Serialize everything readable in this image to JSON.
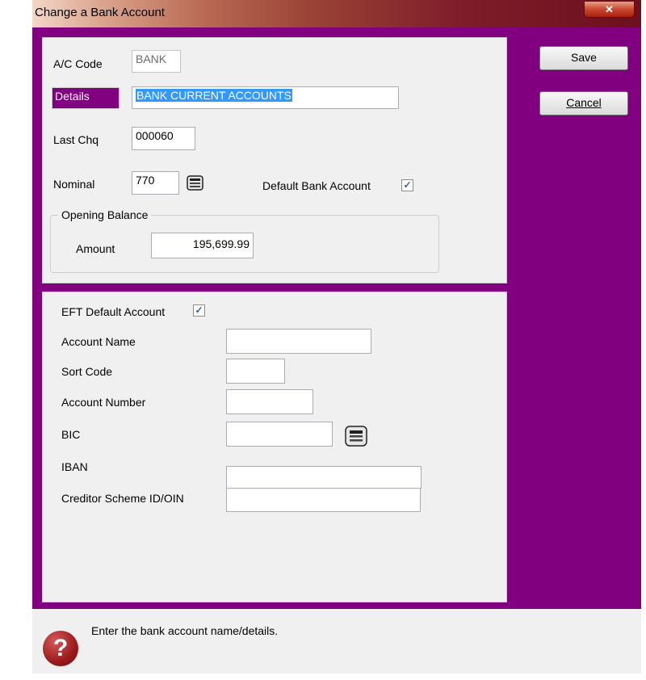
{
  "window": {
    "title": "Change a Bank Account",
    "close_glyph": "✕"
  },
  "form": {
    "ac_code_label": "A/C Code",
    "ac_code_value": "BANK",
    "details_label": "Details",
    "details_value": "BANK CURRENT ACCOUNTS",
    "last_chq_label": "Last Chq",
    "last_chq_value": "000060",
    "nominal_label": "Nominal",
    "nominal_value": "770",
    "default_bank_label": "Default Bank Account",
    "default_bank_checked": true,
    "opening_balance_title": "Opening Balance",
    "amount_label": "Amount",
    "amount_value": "195,699.99"
  },
  "eft": {
    "default_label": "EFT Default Account",
    "default_checked": true,
    "account_name_label": "Account Name",
    "account_name_value": "",
    "sort_code_label": "Sort Code",
    "sort_code_value": "",
    "account_number_label": "Account Number",
    "account_number_value": "",
    "bic_label": "BIC",
    "bic_value": "",
    "iban_label": "IBAN",
    "iban_value": "",
    "creditor_label": "Creditor Scheme ID/OIN",
    "creditor_value": ""
  },
  "buttons": {
    "save_label": "Save",
    "cancel_label": "Cancel"
  },
  "status": {
    "message": "Enter the bank account name/details.",
    "help_glyph": "?"
  },
  "colors": {
    "frame": "#800080",
    "selection": "#3399ff",
    "panel": "#f0f0f0"
  },
  "icons": {
    "lookup": "lookup-book-icon",
    "checkmark": "check-icon",
    "help": "question-icon"
  }
}
